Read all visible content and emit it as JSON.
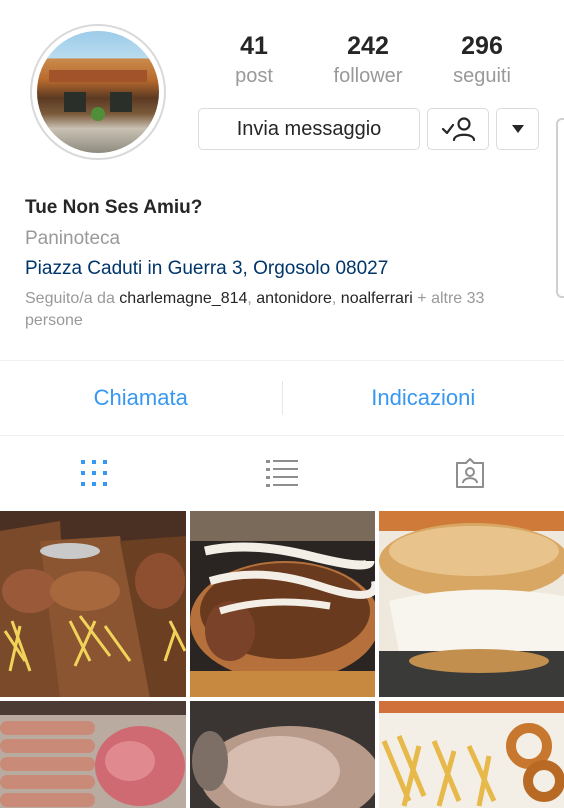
{
  "profile": {
    "posts_count": "41",
    "posts_label": "post",
    "followers_count": "242",
    "followers_label": "follower",
    "following_count": "296",
    "following_label": "seguiti"
  },
  "actions": {
    "message_label": "Invia messaggio"
  },
  "bio": {
    "name": "Tue Non Ses Amiu?",
    "category": "Paninoteca",
    "address": "Piazza Caduti in Guerra 3, Orgosolo 08027",
    "followed_prefix": "Seguito/a da ",
    "followed_users": [
      "charlemagne_814",
      "antonidore",
      "noalferrari"
    ],
    "followed_sep": ", ",
    "followed_suffix": " + altre 33 persone"
  },
  "contact": {
    "call_label": "Chiamata",
    "directions_label": "Indicazioni"
  },
  "colors": {
    "link_blue": "#3897f0",
    "address_blue": "#003569",
    "secondary_text": "#999999"
  }
}
